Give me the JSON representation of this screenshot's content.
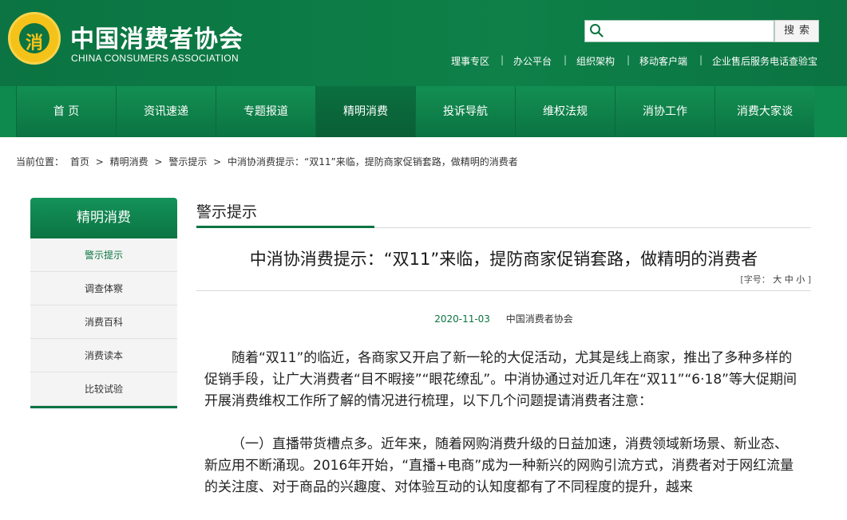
{
  "header": {
    "logo_emblem_text": "消",
    "title": "中国消费者协会",
    "subtitle": "CHINA CONSUMERS ASSOCIATION",
    "search": {
      "placeholder": "",
      "button_label": "搜索"
    },
    "top_links": [
      "理事专区",
      "办公平台",
      "组织架构",
      "移动客户端",
      "企业售后服务电话查验宝"
    ],
    "separator": "|"
  },
  "nav": {
    "items": [
      "首 页",
      "资讯速递",
      "专题报道",
      "精明消费",
      "投诉导航",
      "维权法规",
      "消协工作",
      "消费大家谈"
    ],
    "active_index": 3
  },
  "breadcrumb": {
    "prefix": "当前位置：",
    "items": [
      "首页",
      "精明消费",
      "警示提示",
      "中消协消费提示：“双11”来临，提防商家促销套路，做精明的消费者"
    ],
    "arrow": ">"
  },
  "sidebar": {
    "heading": "精明消费",
    "items": [
      "警示提示",
      "调查体察",
      "消费百科",
      "消费读本",
      "比较试验"
    ],
    "current_index": 0
  },
  "section": {
    "title": "警示提示"
  },
  "article": {
    "title": "中消协消费提示：“双11”来临，提防商家促销套路，做精明的消费者",
    "font_size_label": "[字号：",
    "font_size_options": [
      "大",
      "中",
      "小"
    ],
    "font_size_close": "]",
    "date": "2020-11-03",
    "source": "中国消费者协会",
    "paragraphs": [
      "随着“双11”的临近，各商家又开启了新一轮的大促活动，尤其是线上商家，推出了多种多样的促销手段，让广大消费者“目不暇接”“眼花缭乱”。中消协通过对近几年在“双11”“6·18”等大促期间开展消费维权工作所了解的情况进行梳理，以下几个问题提请消费者注意：",
      "（一）直播带货槽点多。近年来，随着网购消费升级的日益加速，消费领域新场景、新业态、新应用不断涌现。2016年开始，“直播+电商”成为一种新兴的网购引流方式，消费者对于网红流量的关注度、对于商品的兴趣度、对体验互动的认知度都有了不同程度的提升，越来"
    ]
  },
  "colors": {
    "brand_green": "#0b7442",
    "emblem_gold": "#f5c21a"
  }
}
